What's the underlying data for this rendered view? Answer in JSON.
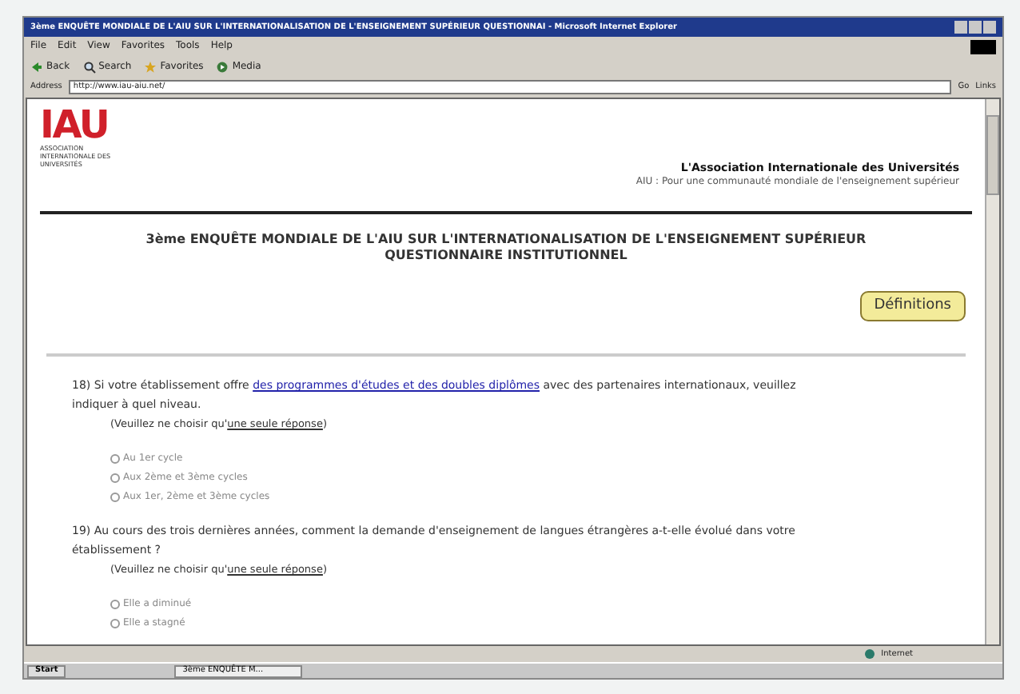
{
  "window": {
    "title": "3ème ENQUÊTE MONDIALE DE L'AIU SUR L'INTERNATIONALISATION DE L'ENSEIGNEMENT SUPÉRIEUR QUESTIONNAI - Microsoft Internet Explorer"
  },
  "menu": [
    "File",
    "Edit",
    "View",
    "Favorites",
    "Tools",
    "Help"
  ],
  "toolbar": [
    {
      "kind": "back",
      "label": "Back"
    },
    {
      "kind": "search",
      "label": "Search"
    },
    {
      "kind": "favorites",
      "label": "Favorites"
    },
    {
      "kind": "media",
      "label": "Media"
    }
  ],
  "address": {
    "label": "Address",
    "value": "http://www.iau-aiu.net/",
    "go": "Go",
    "links": "Links"
  },
  "header": {
    "logo_text": "IAU",
    "logo_caption": "ASSOCIATION INTERNATIONALE DES UNIVERSITÉS",
    "org": "L'Association Internationale des Universités",
    "tagline": "AIU : Pour une communauté mondiale de l'enseignement supérieur"
  },
  "page_title": [
    "3ème ENQUÊTE MONDIALE DE L'AIU SUR L'INTERNATIONALISATION DE L'ENSEIGNEMENT SUPÉRIEUR",
    "QUESTIONNAIRE INSTITUTIONNEL"
  ],
  "definitions_button": "Définitions",
  "questions": [
    {
      "before": "18) Si votre établissement offre ",
      "link": "des programmes d'études et des doubles diplômes",
      "after": " avec des partenaires internationaux, veuillez indiquer à quel niveau.",
      "hint": "(Veuillez ne choisir qu'",
      "hint_link": "une seule réponse",
      "hint_end": ")",
      "options": [
        {
          "label": "Au 1er cycle",
          "selected": false
        },
        {
          "label": "Aux 2ème et 3ème cycles",
          "selected": false
        },
        {
          "label": "Aux 1er, 2ème et 3ème cycles",
          "selected": false
        }
      ]
    },
    {
      "before": "19) Au cours des trois dernières années, comment la demande d'enseignement de langues étrangères a-t-elle évolué dans votre établissement ?",
      "hint": "(Veuillez ne choisir qu'",
      "hint_link": "une seule réponse",
      "hint_end": ")",
      "options": [
        {
          "label": "Elle a diminué",
          "selected": false
        },
        {
          "label": "Elle a stagné",
          "selected": false
        }
      ]
    }
  ],
  "status_bar": {
    "zone": "Internet"
  },
  "taskbar": {
    "start": "Start",
    "task": "3ème ENQUÊTE M..."
  }
}
